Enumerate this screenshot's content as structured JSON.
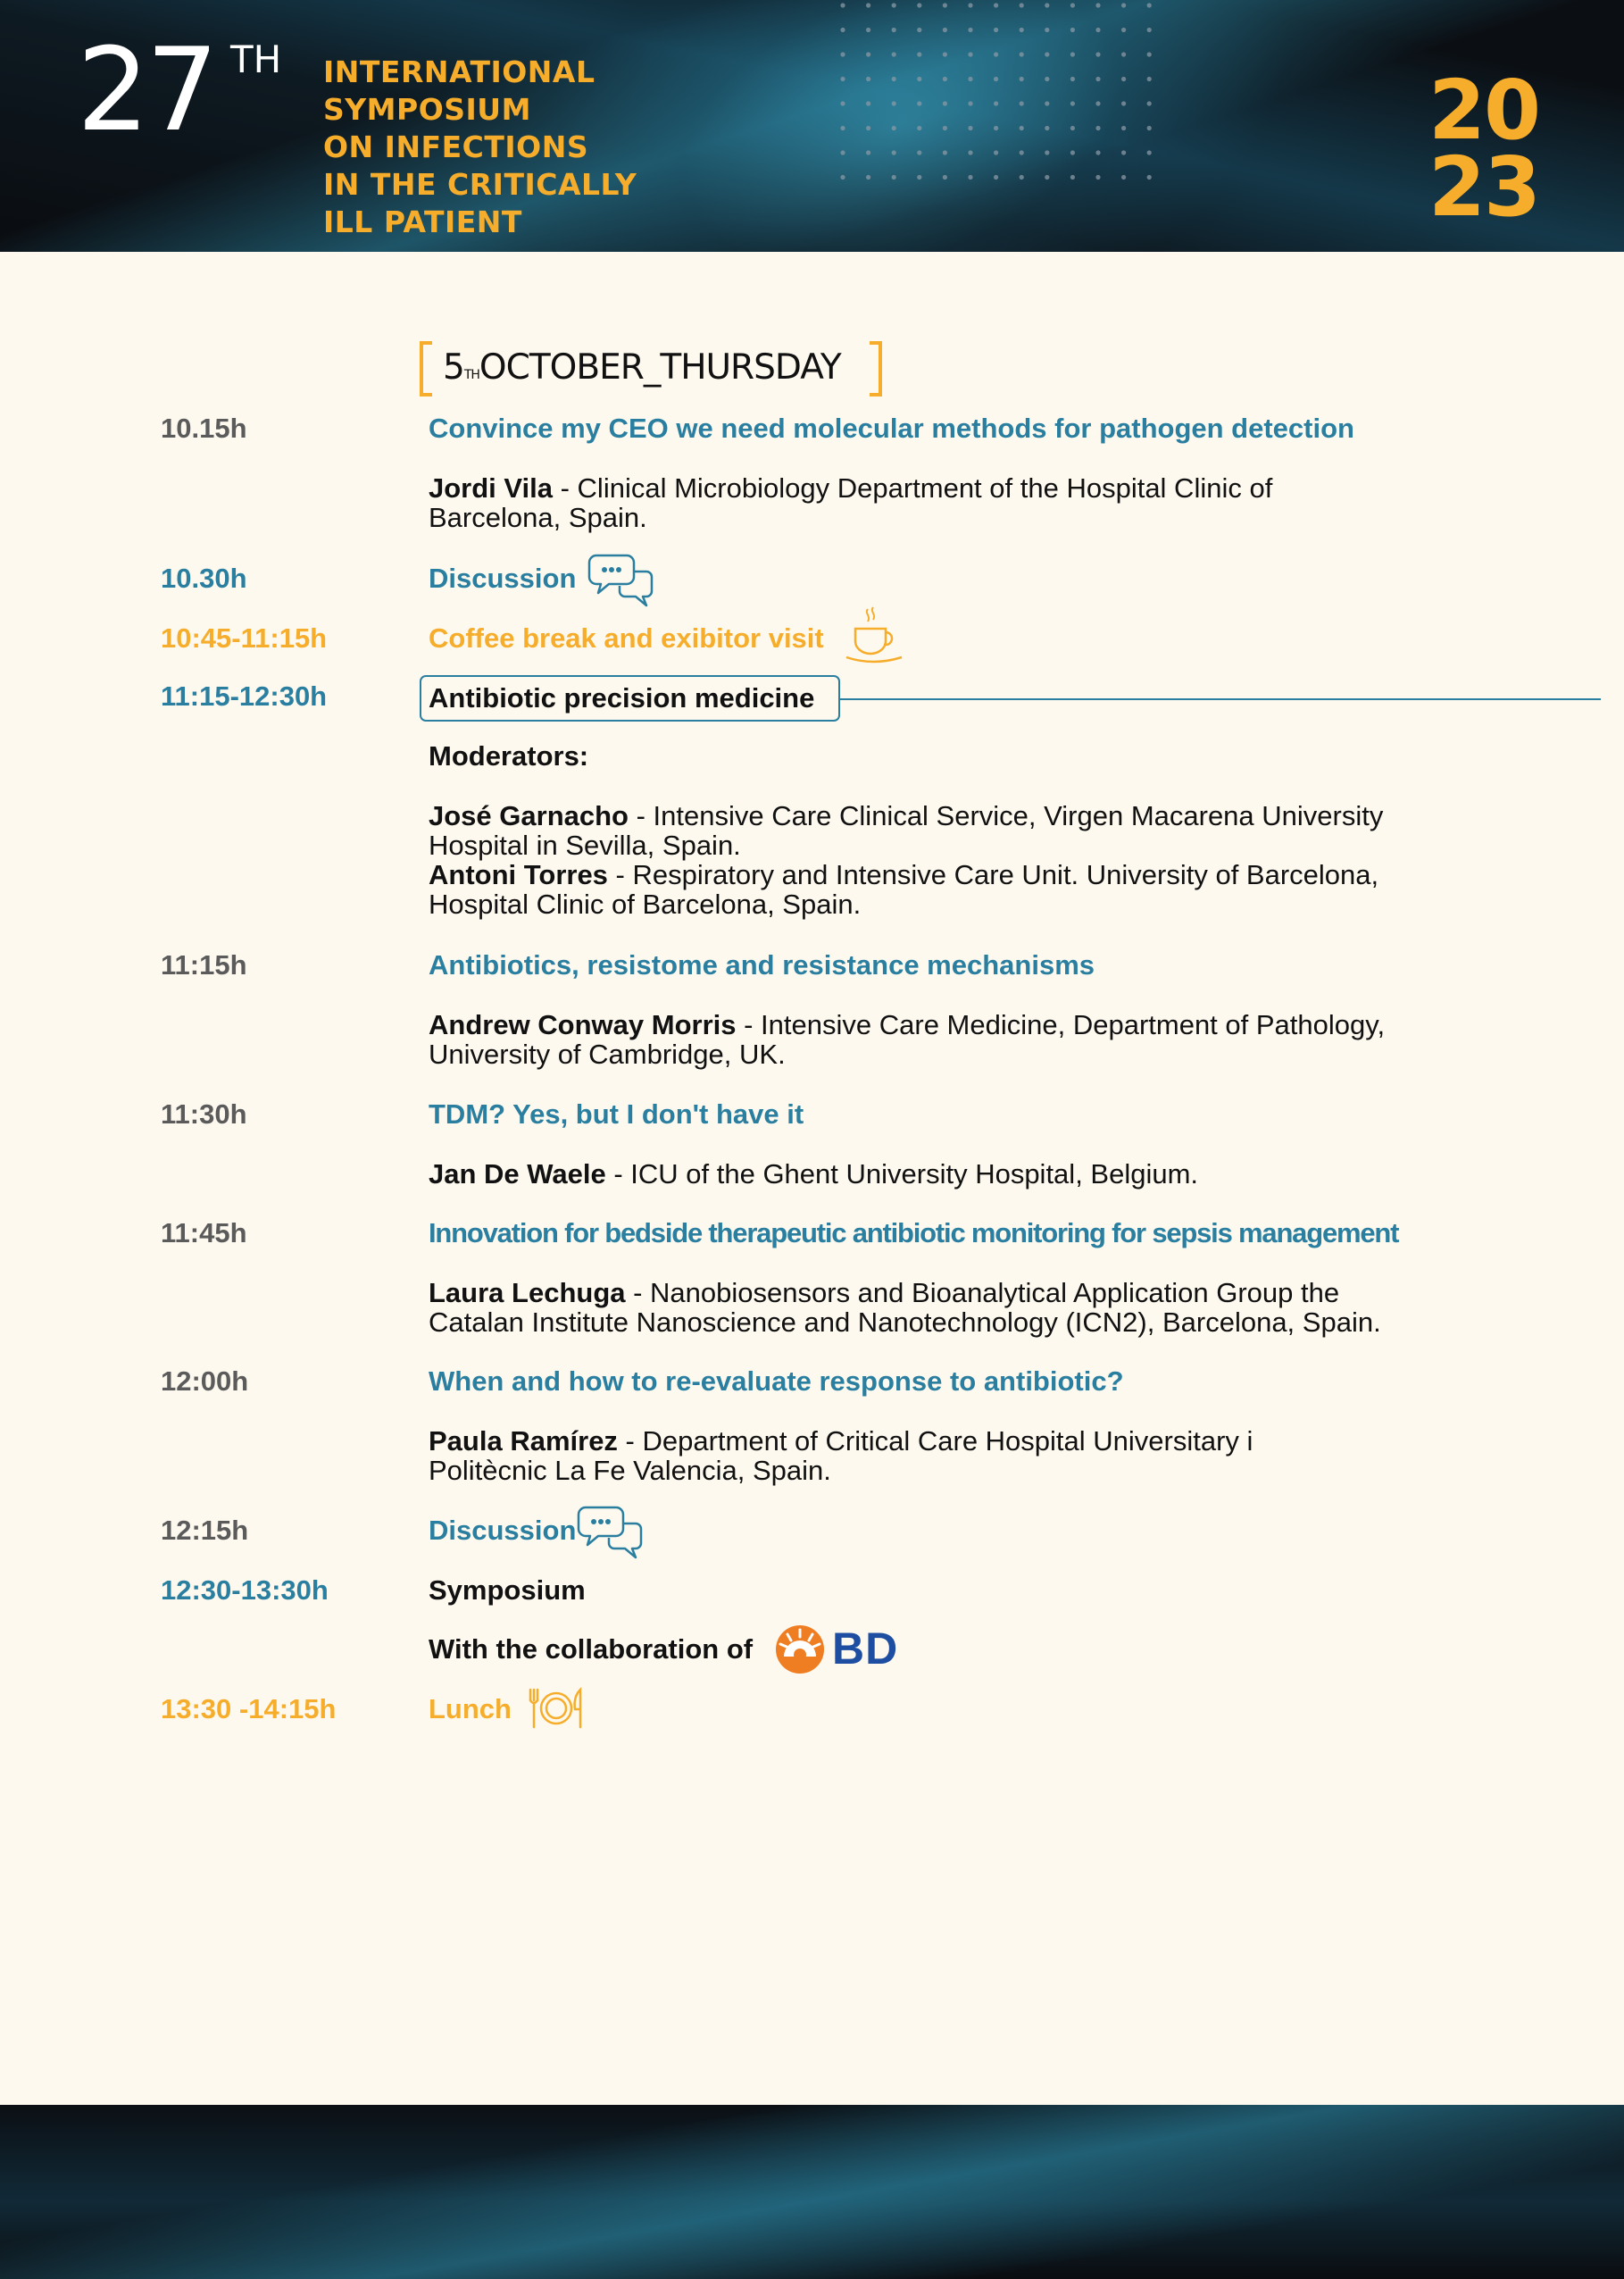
{
  "header": {
    "edition_number": "27",
    "edition_suffix": "TH",
    "title_lines": [
      "INTERNATIONAL",
      "SYMPOSIUM",
      "ON INFECTIONS",
      "IN THE CRITICALLY",
      "ILL PATIENT"
    ],
    "year_top": "20",
    "year_bottom": "23"
  },
  "day": {
    "number": "5",
    "suffix": "TH",
    "label": "OCTOBER_THURSDAY"
  },
  "colors": {
    "background": "#fef9ef",
    "gold": "#f6ad2b",
    "teal": "#2a7fa0",
    "grey": "#5b5b5b",
    "bd_orange": "#ef7d22",
    "bd_blue": "#1e4ea1"
  },
  "program": {
    "t1": {
      "time": "10.15h",
      "title": "Convince my CEO we need molecular methods for pathogen detection",
      "speaker_name": "Jordi Vila",
      "speaker_line1": " - Clinical Microbiology Department of the Hospital Clinic of",
      "speaker_line2": "Barcelona, Spain."
    },
    "d1": {
      "time": "10.30h",
      "title": "Discussion",
      "icon": "chat-bubbles-icon"
    },
    "coffee": {
      "time": "10:45-11:15h",
      "title": "Coffee break  and exibitor visit",
      "icon": "coffee-cup-icon"
    },
    "session": {
      "time": "11:15-12:30h",
      "title": "Antibiotic precision medicine",
      "moderators_label": "Moderators:",
      "mod1_name": "José Garnacho",
      "mod1_line1": " - Intensive Care Clinical Service, Virgen Macarena University",
      "mod1_line2": "Hospital in Sevilla, Spain.",
      "mod2_name": "Antoni Torres",
      "mod2_line1": " - Respiratory and Intensive Care Unit. University of Barcelona,",
      "mod2_line2": "Hospital Clinic of Barcelona, Spain."
    },
    "t2": {
      "time": "11:15h",
      "title": "Antibiotics, resistome and resistance mechanisms",
      "speaker_name": "Andrew Conway Morris",
      "speaker_line1": " - Intensive Care Medicine,  Department of Pathology,",
      "speaker_line2": "University of Cambridge, UK."
    },
    "t3": {
      "time": "11:30h",
      "title": "TDM?  Yes, but I don't have it",
      "speaker_name": "Jan De Waele",
      "speaker_line1": " - ICU of the Ghent University Hospital, Belgium."
    },
    "t4": {
      "time": "11:45h",
      "title": "Innovation for bedside therapeutic antibiotic monitoring for sepsis management",
      "speaker_name": "Laura Lechuga",
      "speaker_line1": " - Nanobiosensors and Bioanalytical Application Group the",
      "speaker_line2": "Catalan Institute Nanoscience and Nanotechnology (ICN2), Barcelona, Spain."
    },
    "t5": {
      "time": "12:00h",
      "title": "When and how to re-evaluate response to antibiotic?",
      "speaker_name": "Paula Ramírez",
      "speaker_line1": " - Department of Critical Care Hospital Universitary i",
      "speaker_line2": "Politècnic La Fe Valencia, Spain."
    },
    "d2": {
      "time": "12:15h",
      "title": "Discussion",
      "icon": "chat-bubbles-icon"
    },
    "symposium": {
      "time": "12:30-13:30h",
      "title": "Symposium",
      "collab_label": "With the collaboration of",
      "sponsor": "BD",
      "sponsor_icon": "bd-logo-icon"
    },
    "lunch": {
      "time": "13:30 -14:15h",
      "title": "Lunch",
      "icon": "plate-cutlery-icon"
    }
  }
}
